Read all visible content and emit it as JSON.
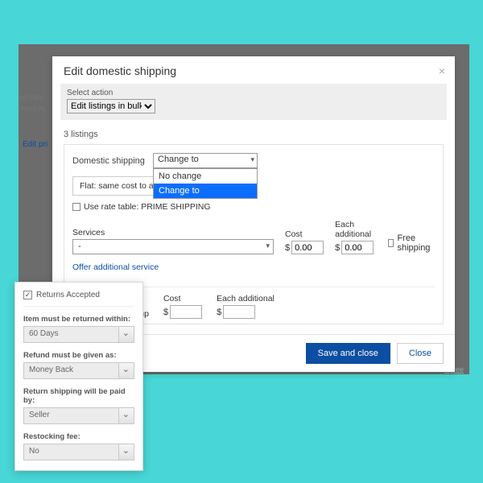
{
  "backdrop": {
    "line1": "ad rate",
    "line2": "ment re",
    "edit_link": "Edit pri"
  },
  "bottom_link": "Agree",
  "modal": {
    "title": "Edit domestic shipping",
    "action_label": "Select action",
    "action_value": "Edit listings in bulk",
    "count": "3 listings",
    "domestic_label": "Domestic shipping",
    "combo_value": "Change to",
    "combo_items": [
      "No change",
      "Change to"
    ],
    "flat_text": "Flat: same cost to all",
    "rate_table": "Use rate table: PRIME SHIPPING",
    "services_label": "Services",
    "services_value": "-",
    "cost_label": "Cost",
    "eachadd_label": "Each additional",
    "cost_value": "0.00",
    "eachadd_value": "0.00",
    "free_ship": "Free shipping",
    "offer_link": "Offer additional service",
    "local_pickup": "Offer local pickup",
    "pickup_cost_label": "Cost",
    "pickup_eachadd_label": "Each additional",
    "currency": "$",
    "save_btn": "Save and close",
    "close_btn": "Close"
  },
  "returns": {
    "accepted": "Returns Accepted",
    "fields": [
      {
        "label": "Item must be returned within:",
        "value": "60 Days"
      },
      {
        "label": "Refund must be given as:",
        "value": "Money Back"
      },
      {
        "label": "Return shipping will be paid by:",
        "value": "Seller"
      },
      {
        "label": "Restocking fee:",
        "value": "No"
      }
    ]
  }
}
